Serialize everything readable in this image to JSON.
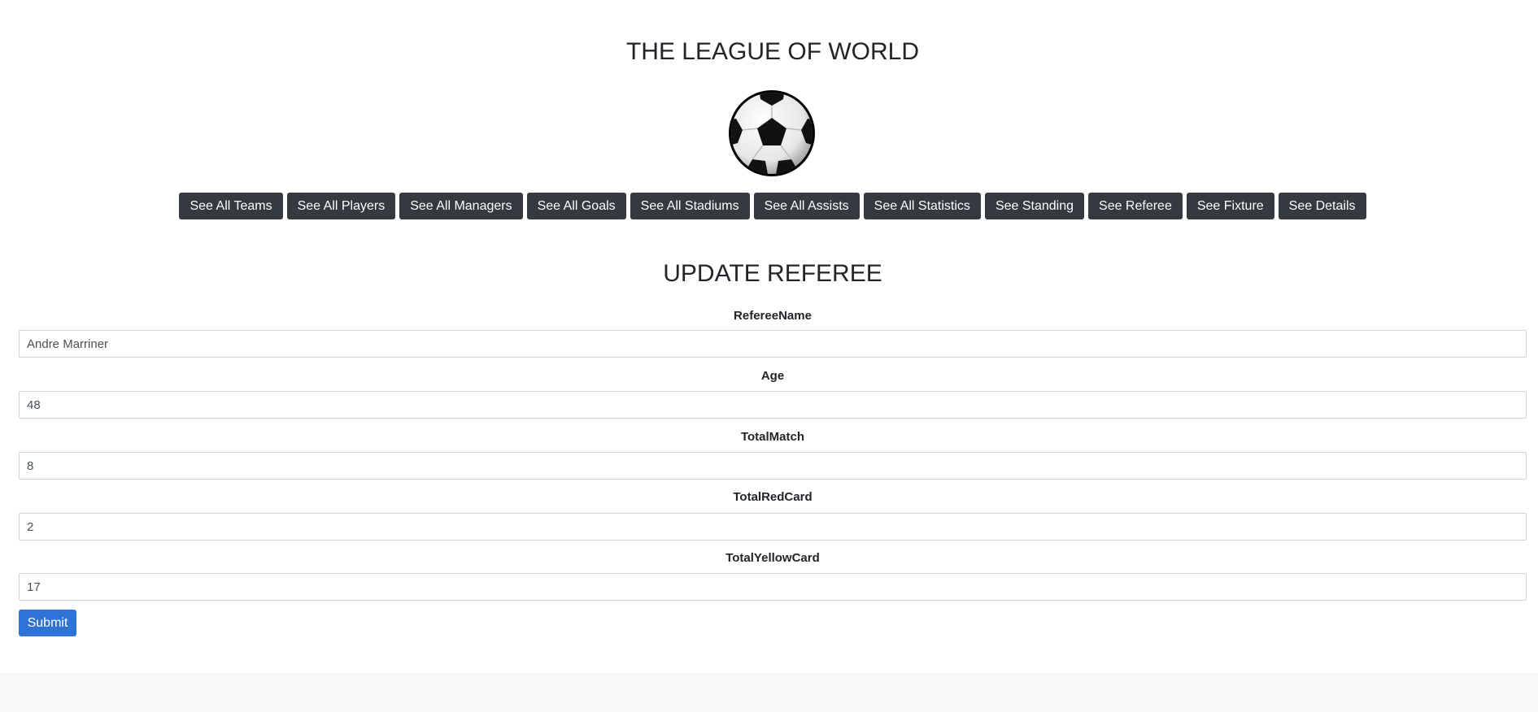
{
  "site_title": "THE LEAGUE OF WORLD",
  "logo": {
    "icon": "soccer-ball-icon"
  },
  "nav": [
    "See All Teams",
    "See All Players",
    "See All Managers",
    "See All Goals",
    "See All Stadiums",
    "See All Assists",
    "See All Statistics",
    "See Standing",
    "See Referee",
    "See Fixture",
    "See Details"
  ],
  "form": {
    "title": "UPDATE REFEREE",
    "fields": [
      {
        "label": "RefereeName",
        "value": "Andre Marriner"
      },
      {
        "label": "Age",
        "value": "48"
      },
      {
        "label": "TotalMatch",
        "value": "8"
      },
      {
        "label": "TotalRedCard",
        "value": "2"
      },
      {
        "label": "TotalYellowCard",
        "value": "17"
      }
    ],
    "submit_label": "Submit"
  },
  "colors": {
    "nav_button_bg": "#343a40",
    "submit_bg": "#2f73d9",
    "footer_bg": "#f8f8f8"
  }
}
